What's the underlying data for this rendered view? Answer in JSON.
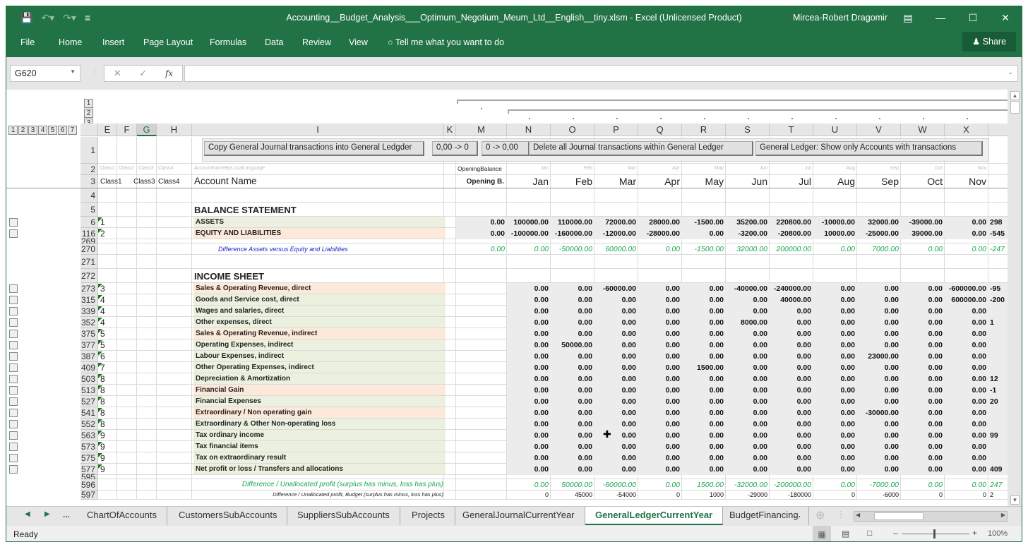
{
  "window": {
    "title": "Accounting__Budget_Analysis___Optimum_Negotium_Meum_Ltd__English__tiny.xlsm  -  Excel (Unlicensed Product)",
    "user": "Mircea-Robert Dragomir",
    "qat_icons": [
      "save-icon",
      "undo-icon",
      "redo-icon",
      "customize-icon"
    ]
  },
  "ribbon": {
    "tabs": [
      "File",
      "Home",
      "Insert",
      "Page Layout",
      "Formulas",
      "Data",
      "Review",
      "View"
    ],
    "tell_me": "Tell me what you want to do",
    "share": "Share"
  },
  "formula_bar": {
    "name_box": "G620",
    "formula": ""
  },
  "outline": {
    "row_levels": [
      "1",
      "2",
      "3",
      "4",
      "5",
      "6",
      "7"
    ],
    "col_levels": [
      "1",
      "2",
      "3"
    ]
  },
  "columns": [
    "E",
    "F",
    "G",
    "H",
    "I",
    "K",
    "M",
    "N",
    "O",
    "P",
    "Q",
    "R",
    "S",
    "T",
    "U",
    "V",
    "W",
    "X"
  ],
  "selected_column": "G",
  "buttons": {
    "copy_journal": "Copy General Journal transactions into General Ledgder",
    "zero_to_0": "0,00 -> 0",
    "zero_to_00": "0 -> 0,00",
    "delete_journal": "Delete all Journal transactions within General Ledger",
    "show_only": "General Ledger:  Show only Accounts with transactions"
  },
  "header_rows": {
    "row2": {
      "classes": [
        "Class1",
        "Class2",
        "Class3",
        "Class4"
      ],
      "account": "AccountNameByLocalLanguage",
      "opening": "OpeningBalance",
      "months": [
        "Jan",
        "Feb",
        "Mar",
        "Apr",
        "May",
        "Jun",
        "Jul",
        "Aug",
        "Sep",
        "Oct",
        "Nov"
      ]
    },
    "row3": {
      "class1": "Class1",
      "class3": "Class3",
      "class4": "Class4",
      "account": "Account Name",
      "opening": "Opening B.",
      "months": [
        "Jan",
        "Feb",
        "Mar",
        "Apr",
        "May",
        "Jun",
        "Jul",
        "Aug",
        "Sep",
        "Oct",
        "Nov"
      ]
    }
  },
  "sections": {
    "balance": "BALANCE STATEMENT",
    "income": "INCOME SHEET"
  },
  "rows": [
    {
      "row": "4",
      "type": "blank"
    },
    {
      "row": "5",
      "type": "section",
      "label_key": "balance"
    },
    {
      "row": "6",
      "type": "account",
      "cls": "1",
      "name": "ASSETS",
      "color": "green",
      "opening": "0.00",
      "values": [
        "100000.00",
        "110000.00",
        "72000.00",
        "28000.00",
        "-1500.00",
        "35200.00",
        "220800.00",
        "-10000.00",
        "32000.00",
        "-39000.00",
        "0.00",
        "298"
      ]
    },
    {
      "row": "116",
      "type": "account",
      "cls": "2",
      "name": "EQUITY AND LIABILITIES",
      "color": "orange",
      "opening": "0.00",
      "values": [
        "-100000.00",
        "-160000.00",
        "-12000.00",
        "-28000.00",
        "0.00",
        "-3200.00",
        "-20800.00",
        "10000.00",
        "-25000.00",
        "39000.00",
        "0.00",
        "-545"
      ]
    },
    {
      "row": "269",
      "type": "thin"
    },
    {
      "row": "270",
      "type": "diff",
      "name": "Difference Assets versus Equity and Liabilities",
      "opening": "0.00",
      "values": [
        "0.00",
        "-50000.00",
        "60000.00",
        "0.00",
        "-1500.00",
        "32000.00",
        "200000.00",
        "0.00",
        "7000.00",
        "0.00",
        "0.00",
        "-247"
      ]
    },
    {
      "row": "271",
      "type": "blank"
    },
    {
      "row": "272",
      "type": "section",
      "label_key": "income"
    },
    {
      "row": "273",
      "type": "account",
      "cls": "3",
      "name": "Sales & Operating Revenue, direct",
      "color": "orange",
      "values": [
        "0.00",
        "0.00",
        "-60000.00",
        "0.00",
        "0.00",
        "-40000.00",
        "-240000.00",
        "0.00",
        "0.00",
        "0.00",
        "-600000.00",
        "-95"
      ]
    },
    {
      "row": "315",
      "type": "account",
      "cls": "4",
      "name": "Goods and Service cost, direct",
      "color": "green",
      "values": [
        "0.00",
        "0.00",
        "0.00",
        "0.00",
        "0.00",
        "0.00",
        "40000.00",
        "0.00",
        "0.00",
        "0.00",
        "600000.00",
        "-200"
      ]
    },
    {
      "row": "339",
      "type": "account",
      "cls": "4",
      "name": "Wages and salaries, direct",
      "color": "green",
      "values": [
        "0.00",
        "0.00",
        "0.00",
        "0.00",
        "0.00",
        "0.00",
        "0.00",
        "0.00",
        "0.00",
        "0.00",
        "0.00",
        ""
      ]
    },
    {
      "row": "352",
      "type": "account",
      "cls": "4",
      "name": "Other expenses, direct",
      "color": "green",
      "values": [
        "0.00",
        "0.00",
        "0.00",
        "0.00",
        "0.00",
        "8000.00",
        "0.00",
        "0.00",
        "0.00",
        "0.00",
        "0.00",
        "1"
      ]
    },
    {
      "row": "375",
      "type": "account",
      "cls": "5",
      "name": "Sales & Operating Revenue, indirect",
      "color": "orange",
      "values": [
        "0.00",
        "0.00",
        "0.00",
        "0.00",
        "0.00",
        "0.00",
        "0.00",
        "0.00",
        "0.00",
        "0.00",
        "0.00",
        ""
      ]
    },
    {
      "row": "377",
      "type": "account",
      "cls": "5",
      "name": "Operating Expenses, indirect",
      "color": "green",
      "values": [
        "0.00",
        "50000.00",
        "0.00",
        "0.00",
        "0.00",
        "0.00",
        "0.00",
        "0.00",
        "0.00",
        "0.00",
        "0.00",
        ""
      ]
    },
    {
      "row": "387",
      "type": "account",
      "cls": "6",
      "name": "Labour Expenses, indirect",
      "color": "green",
      "values": [
        "0.00",
        "0.00",
        "0.00",
        "0.00",
        "0.00",
        "0.00",
        "0.00",
        "0.00",
        "23000.00",
        "0.00",
        "0.00",
        ""
      ]
    },
    {
      "row": "409",
      "type": "account",
      "cls": "7",
      "name": "Other Operating Expenses, indirect",
      "color": "green",
      "values": [
        "0.00",
        "0.00",
        "0.00",
        "0.00",
        "1500.00",
        "0.00",
        "0.00",
        "0.00",
        "0.00",
        "0.00",
        "0.00",
        ""
      ]
    },
    {
      "row": "503",
      "type": "account",
      "cls": "8",
      "name": "Depreciation & Amortization",
      "color": "green",
      "values": [
        "0.00",
        "0.00",
        "0.00",
        "0.00",
        "0.00",
        "0.00",
        "0.00",
        "0.00",
        "0.00",
        "0.00",
        "0.00",
        "12"
      ]
    },
    {
      "row": "513",
      "type": "account",
      "cls": "8",
      "name": "Financial Gain",
      "color": "orange",
      "values": [
        "0.00",
        "0.00",
        "0.00",
        "0.00",
        "0.00",
        "0.00",
        "0.00",
        "0.00",
        "0.00",
        "0.00",
        "0.00",
        "-1"
      ]
    },
    {
      "row": "527",
      "type": "account",
      "cls": "8",
      "name": "Financial Expenses",
      "color": "green",
      "values": [
        "0.00",
        "0.00",
        "0.00",
        "0.00",
        "0.00",
        "0.00",
        "0.00",
        "0.00",
        "0.00",
        "0.00",
        "0.00",
        "20"
      ]
    },
    {
      "row": "541",
      "type": "account",
      "cls": "8",
      "name": "Extraordinary / Non operating gain",
      "color": "orange",
      "values": [
        "0.00",
        "0.00",
        "0.00",
        "0.00",
        "0.00",
        "0.00",
        "0.00",
        "0.00",
        "-30000.00",
        "0.00",
        "0.00",
        ""
      ]
    },
    {
      "row": "552",
      "type": "account",
      "cls": "8",
      "name": "Extraordinary & Other Non-operating loss",
      "color": "green",
      "values": [
        "0.00",
        "0.00",
        "0.00",
        "0.00",
        "0.00",
        "0.00",
        "0.00",
        "0.00",
        "0.00",
        "0.00",
        "0.00",
        ""
      ]
    },
    {
      "row": "563",
      "type": "account",
      "cls": "9",
      "name": "Tax ordinary income",
      "color": "green",
      "values": [
        "0.00",
        "0.00",
        "0.00",
        "0.00",
        "0.00",
        "0.00",
        "0.00",
        "0.00",
        "0.00",
        "0.00",
        "0.00",
        "99"
      ]
    },
    {
      "row": "573",
      "type": "account",
      "cls": "9",
      "name": "Tax financial items",
      "color": "green",
      "values": [
        "0.00",
        "0.00",
        "0.00",
        "0.00",
        "0.00",
        "0.00",
        "0.00",
        "0.00",
        "0.00",
        "0.00",
        "0.00",
        ""
      ]
    },
    {
      "row": "575",
      "type": "account",
      "cls": "9",
      "name": "Tax on extraordinary result",
      "color": "green",
      "values": [
        "0.00",
        "0.00",
        "0.00",
        "0.00",
        "0.00",
        "0.00",
        "0.00",
        "0.00",
        "0.00",
        "0.00",
        "0.00",
        ""
      ]
    },
    {
      "row": "577",
      "type": "account",
      "cls": "9",
      "name": "Net profit or loss / Transfers and allocations",
      "color": "green",
      "values": [
        "0.00",
        "0.00",
        "0.00",
        "0.00",
        "0.00",
        "0.00",
        "0.00",
        "0.00",
        "0.00",
        "0.00",
        "0.00",
        "409"
      ]
    },
    {
      "row": "595",
      "type": "thin"
    },
    {
      "row": "596",
      "type": "diff2",
      "name": "Difference / Unallocated profit (surplus has minus, loss has plus)",
      "values": [
        "0.00",
        "50000.00",
        "-60000.00",
        "0.00",
        "1500.00",
        "-32000.00",
        "-200000.00",
        "0.00",
        "-7000.00",
        "0.00",
        "0.00",
        "247"
      ]
    },
    {
      "row": "597",
      "type": "budget",
      "name": "Difference / Unallocated profit, Budget (surplus has minus, loss has plus)",
      "values": [
        "0",
        "45000",
        "-54000",
        "0",
        "1000",
        "-29000",
        "-180000",
        "0",
        "-6000",
        "0",
        "0",
        "2"
      ]
    }
  ],
  "sheet_tabs": [
    "ChartOfAccounts",
    "CustomersSubAccounts",
    "SuppliersSubAccounts",
    "Projects",
    "GeneralJournalCurrentYear",
    "GeneralLedgerCurrentYear",
    "BudgetFinancing"
  ],
  "active_tab": "GeneralLedgerCurrentYear",
  "tab_nav": {
    "ellipsis": "...",
    "more": "..."
  },
  "status": {
    "ready": "Ready",
    "zoom": "100%"
  },
  "colors": {
    "accent": "#217346",
    "green_row": "#ebf1de",
    "orange_row": "#fde9d9",
    "diff_green": "#18a84e",
    "diff_blue": "#1f1fd0"
  }
}
